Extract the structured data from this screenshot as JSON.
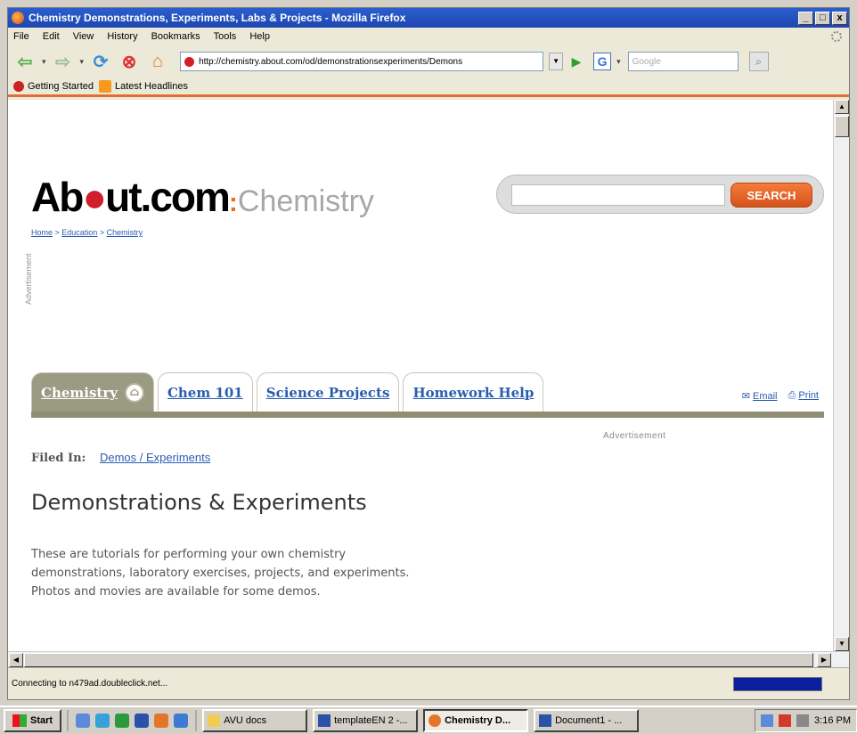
{
  "window": {
    "title": "Chemistry Demonstrations, Experiments, Labs & Projects - Mozilla Firefox",
    "buttons": [
      "_",
      "□",
      "x"
    ]
  },
  "menu": [
    "File",
    "Edit",
    "View",
    "History",
    "Bookmarks",
    "Tools",
    "Help"
  ],
  "nav": {
    "url": "http://chemistry.about.com/od/demonstrationsexperiments/Demons",
    "search_placeholder": "Google",
    "search_engine_icon": "G"
  },
  "bookmarks": [
    "Getting Started",
    "Latest Headlines"
  ],
  "page": {
    "logo_about_pre": "Ab",
    "logo_about_post": "ut.com",
    "logo_colon": ":",
    "logo_category": "Chemistry",
    "breadcrumb": [
      "Home",
      "Education",
      "Chemistry"
    ],
    "search_button": "SEARCH",
    "advert_side": "Advertisement",
    "tabs": [
      "Chemistry",
      "Chem 101",
      "Science Projects",
      "Homework Help"
    ],
    "tools": {
      "email": "Email",
      "print": "Print"
    },
    "filed_label": "Filed In:",
    "filed_link": "Demos / Experiments",
    "advert_label": "Advertisement",
    "heading": "Demonstrations & Experiments",
    "intro": "These are tutorials for performing your own chemistry demonstrations, laboratory exercises, projects, and experiments. Photos and movies are available for some demos."
  },
  "status": "Connecting to n479ad.doubleclick.net...",
  "taskbar": {
    "start": "Start",
    "tasks": [
      "AVU docs",
      "templateEN 2 -...",
      "Chemistry D...",
      "Document1 - ..."
    ],
    "clock": "3:16 PM"
  },
  "colors": {
    "accent_orange": "#e96d1d",
    "link_blue": "#2a5db0",
    "tab_olive": "#9b9a82"
  }
}
